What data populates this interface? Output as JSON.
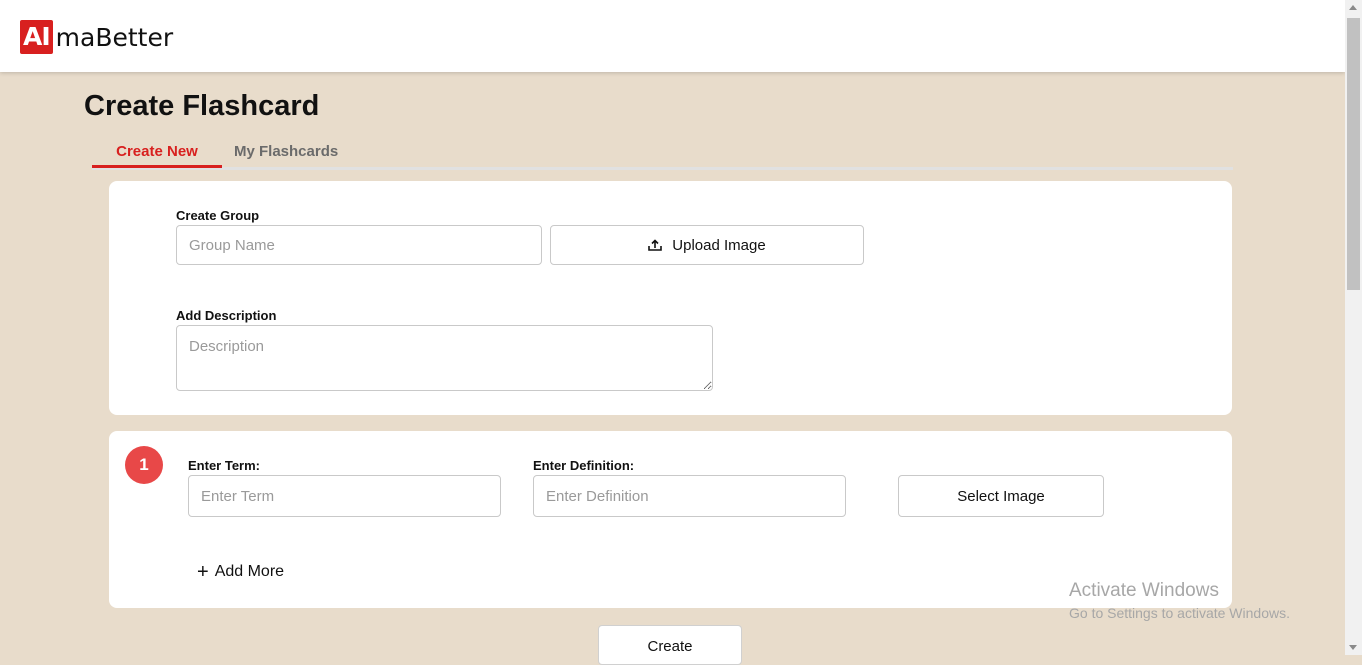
{
  "header": {
    "logo_badge": "AI",
    "logo_text": "maBetter"
  },
  "page": {
    "title": "Create Flashcard"
  },
  "tabs": [
    {
      "label": "Create New",
      "active": true
    },
    {
      "label": "My Flashcards",
      "active": false
    }
  ],
  "group_form": {
    "group_label": "Create Group",
    "group_placeholder": "Group Name",
    "upload_label": "Upload Image",
    "description_label": "Add Description",
    "description_placeholder": "Description"
  },
  "term_card": {
    "number": "1",
    "term_label": "Enter Term:",
    "term_placeholder": "Enter Term",
    "definition_label": "Enter Definition:",
    "definition_placeholder": "Enter Definition",
    "select_image_label": "Select Image",
    "add_more_label": "Add More"
  },
  "actions": {
    "create_label": "Create"
  },
  "watermark": {
    "title": "Activate Windows",
    "subtitle": "Go to Settings to activate Windows."
  },
  "colors": {
    "accent": "#d8201f",
    "page_background": "#e8dccb",
    "badge": "#e84848"
  },
  "icons": {
    "upload": "upload-icon",
    "plus": "plus-icon"
  }
}
